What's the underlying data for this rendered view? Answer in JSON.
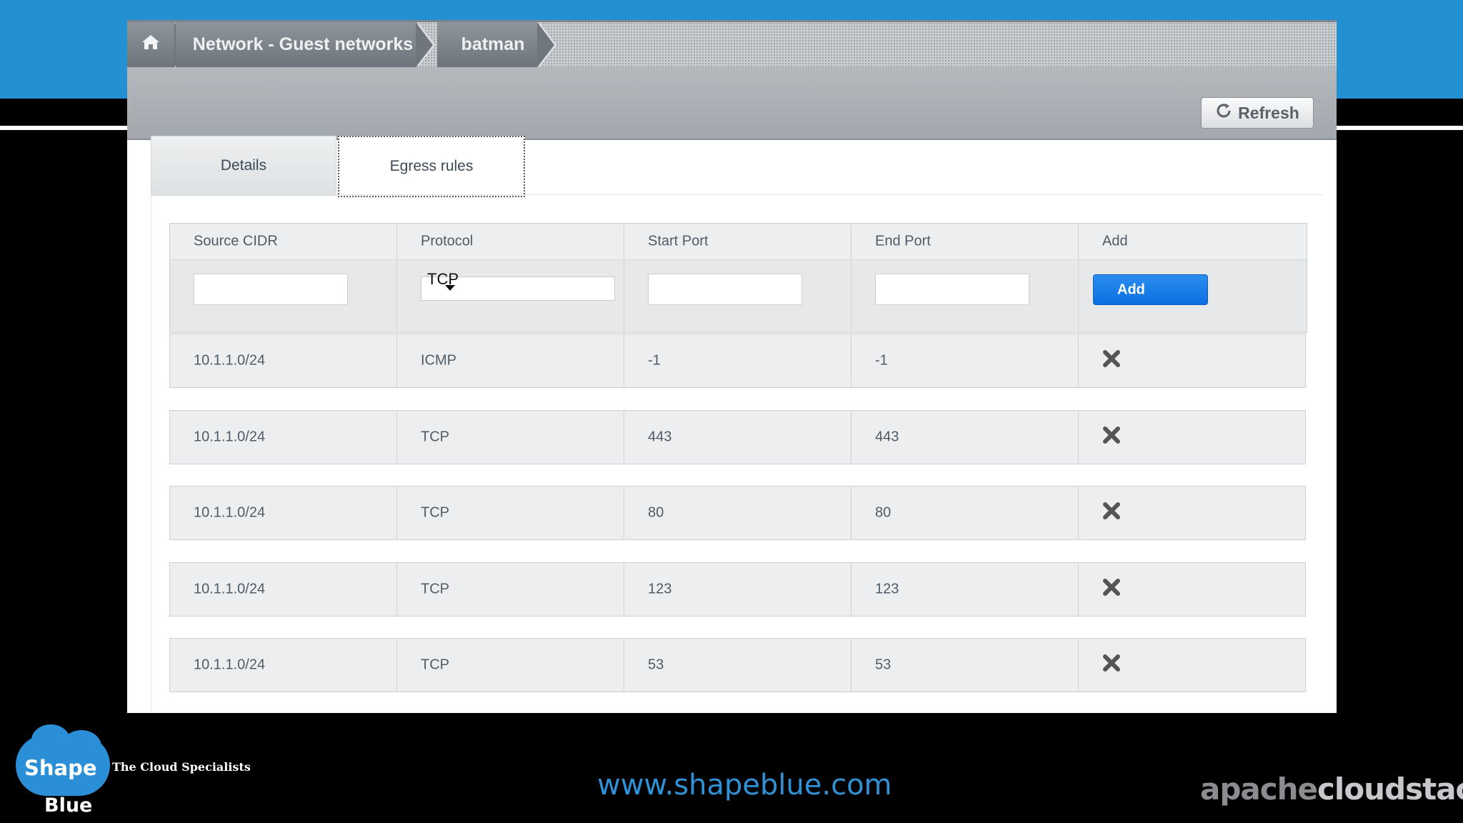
{
  "breadcrumb": {
    "home_icon": "home-icon",
    "items": [
      "Network - Guest networks",
      "batman"
    ]
  },
  "toolbar": {
    "refresh_label": "Refresh",
    "refresh_icon": "refresh-icon"
  },
  "tabs": [
    {
      "label": "Details",
      "active": false
    },
    {
      "label": "Egress rules",
      "active": true
    }
  ],
  "table": {
    "headers": [
      "Source CIDR",
      "Protocol",
      "Start Port",
      "End Port",
      "Add"
    ],
    "new_rule": {
      "source_cidr": "",
      "protocol": "TCP",
      "start_port": "",
      "end_port": "",
      "add_label": "Add"
    },
    "rows": [
      {
        "source_cidr": "10.1.1.0/24",
        "protocol": "ICMP",
        "start_port": "-1",
        "end_port": "-1"
      },
      {
        "source_cidr": "10.1.1.0/24",
        "protocol": "TCP",
        "start_port": "443",
        "end_port": "443"
      },
      {
        "source_cidr": "10.1.1.0/24",
        "protocol": "TCP",
        "start_port": "80",
        "end_port": "80"
      },
      {
        "source_cidr": "10.1.1.0/24",
        "protocol": "TCP",
        "start_port": "123",
        "end_port": "123"
      },
      {
        "source_cidr": "10.1.1.0/24",
        "protocol": "TCP",
        "start_port": "53",
        "end_port": "53"
      }
    ]
  },
  "footer": {
    "url": "www.shapeblue.com",
    "logo": {
      "word1": "Shape",
      "word2": "Blue",
      "tagline": "The Cloud Specialists"
    },
    "brand_part1": "apache",
    "brand_part2": "cloudstack"
  },
  "colors": {
    "header_band": "#2290d3",
    "add_button": "#0a6fe0",
    "url": "#2f92d6"
  }
}
